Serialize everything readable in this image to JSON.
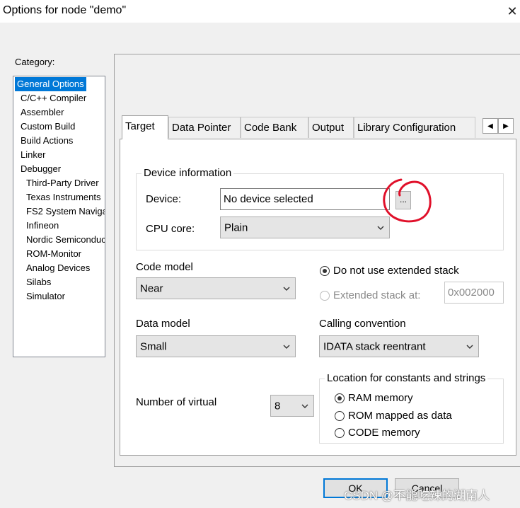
{
  "window": {
    "title": "Options for node \"demo\"",
    "close_icon": "close-icon"
  },
  "category": {
    "label": "Category:",
    "items": [
      {
        "label": "General Options",
        "selected": true
      },
      {
        "label": "C/C++ Compiler"
      },
      {
        "label": "Assembler"
      },
      {
        "label": "Custom Build"
      },
      {
        "label": "Build Actions"
      },
      {
        "label": "Linker"
      },
      {
        "label": "Debugger"
      },
      {
        "label": "Third-Party Driver"
      },
      {
        "label": "Texas Instruments"
      },
      {
        "label": "FS2 System Naviga"
      },
      {
        "label": "Infineon"
      },
      {
        "label": "Nordic Semiconduc"
      },
      {
        "label": "ROM-Monitor"
      },
      {
        "label": "Analog Devices"
      },
      {
        "label": "Silabs"
      },
      {
        "label": "Simulator"
      }
    ]
  },
  "tabs": [
    {
      "label": "Target",
      "active": true
    },
    {
      "label": "Data Pointer"
    },
    {
      "label": "Code Bank"
    },
    {
      "label": "Output"
    },
    {
      "label": "Library Configuration"
    }
  ],
  "tab_scroll": {
    "left_icon": "arrow-left-icon",
    "right_icon": "arrow-right-icon"
  },
  "device_info": {
    "legend": "Device information",
    "device_label": "Device:",
    "device_value": "No device selected",
    "browse_label": "...",
    "cpu_label": "CPU core:",
    "cpu_value": "Plain"
  },
  "code_model": {
    "label": "Code model",
    "value": "Near"
  },
  "stack": {
    "option1": "Do not use extended stack",
    "option2": "Extended stack at:",
    "address": "0x002000"
  },
  "data_model": {
    "label": "Data model",
    "value": "Small"
  },
  "calling_convention": {
    "label": "Calling convention",
    "value": "IDATA stack reentrant"
  },
  "virtual": {
    "label": "Number of virtual",
    "value": "8"
  },
  "location": {
    "legend": "Location for constants and strings",
    "options": [
      "RAM memory",
      "ROM mapped as data",
      "CODE memory"
    ],
    "selected": 0
  },
  "buttons": {
    "ok": "OK",
    "cancel": "Cancel"
  },
  "watermark": "CSDN @不能吃辣的湖南人",
  "annotation_color": "#e0102a"
}
